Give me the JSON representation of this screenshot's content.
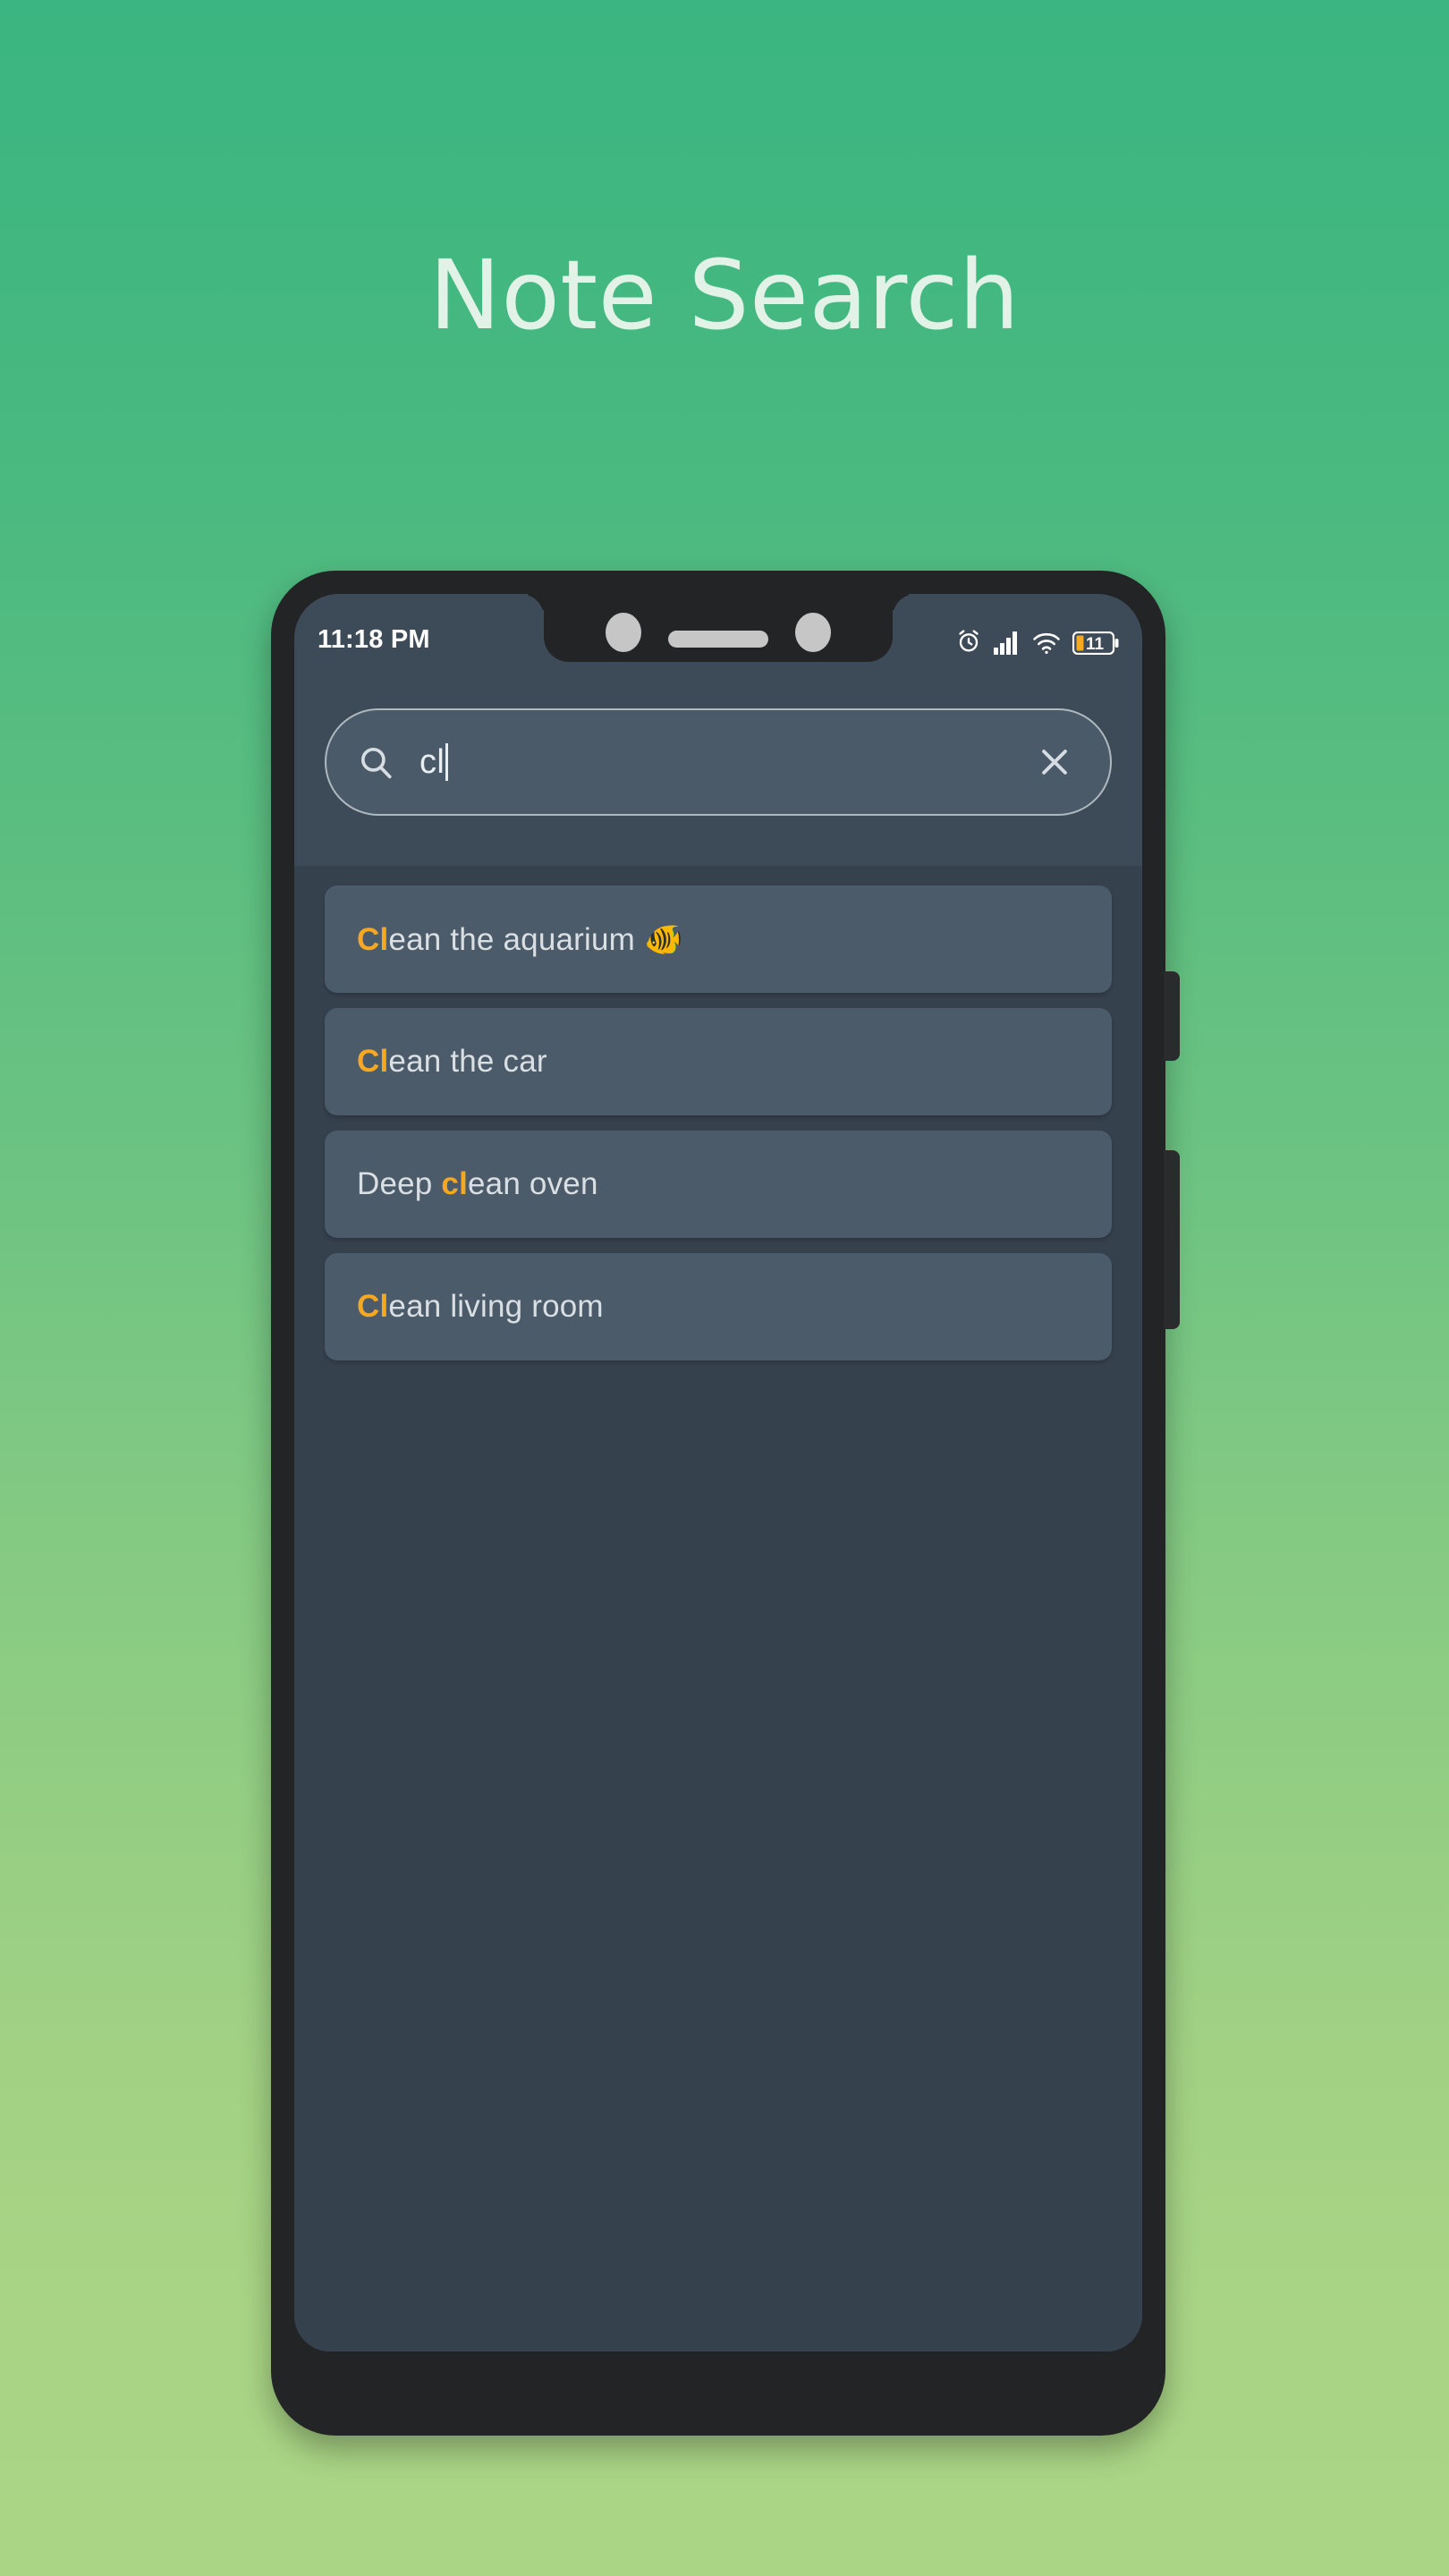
{
  "page": {
    "title": "Note Search",
    "title_color": "#e2f2e6",
    "background_gradient_top": "#3bb581",
    "background_gradient_bottom": "#aad585"
  },
  "phone": {
    "frame_color": "#232425",
    "screen_bg": "#36414e",
    "app_bar_bg": "#3d4a57",
    "card_bg": "#4c5b69"
  },
  "status_bar": {
    "clock": "11:18 PM",
    "battery_level": "11",
    "battery_fill_color": "#f7a823",
    "icons": [
      "alarm-icon",
      "signal-icon",
      "wifi-icon",
      "battery-icon"
    ]
  },
  "search": {
    "value": "cl",
    "placeholder": "Search",
    "search_icon": "search-icon",
    "clear_icon": "close-icon",
    "accent_color": "#f7a823",
    "text_color": "#e8eef2"
  },
  "results": {
    "highlight_color": "#f7a823",
    "text_color": "#d9dfe3",
    "items": [
      {
        "prefix": "",
        "match": "Cl",
        "suffix": "ean the aquarium 🐠"
      },
      {
        "prefix": "",
        "match": "Cl",
        "suffix": "ean the car"
      },
      {
        "prefix": "Deep ",
        "match": "cl",
        "suffix": "ean oven"
      },
      {
        "prefix": "",
        "match": "Cl",
        "suffix": "ean living room"
      }
    ]
  }
}
